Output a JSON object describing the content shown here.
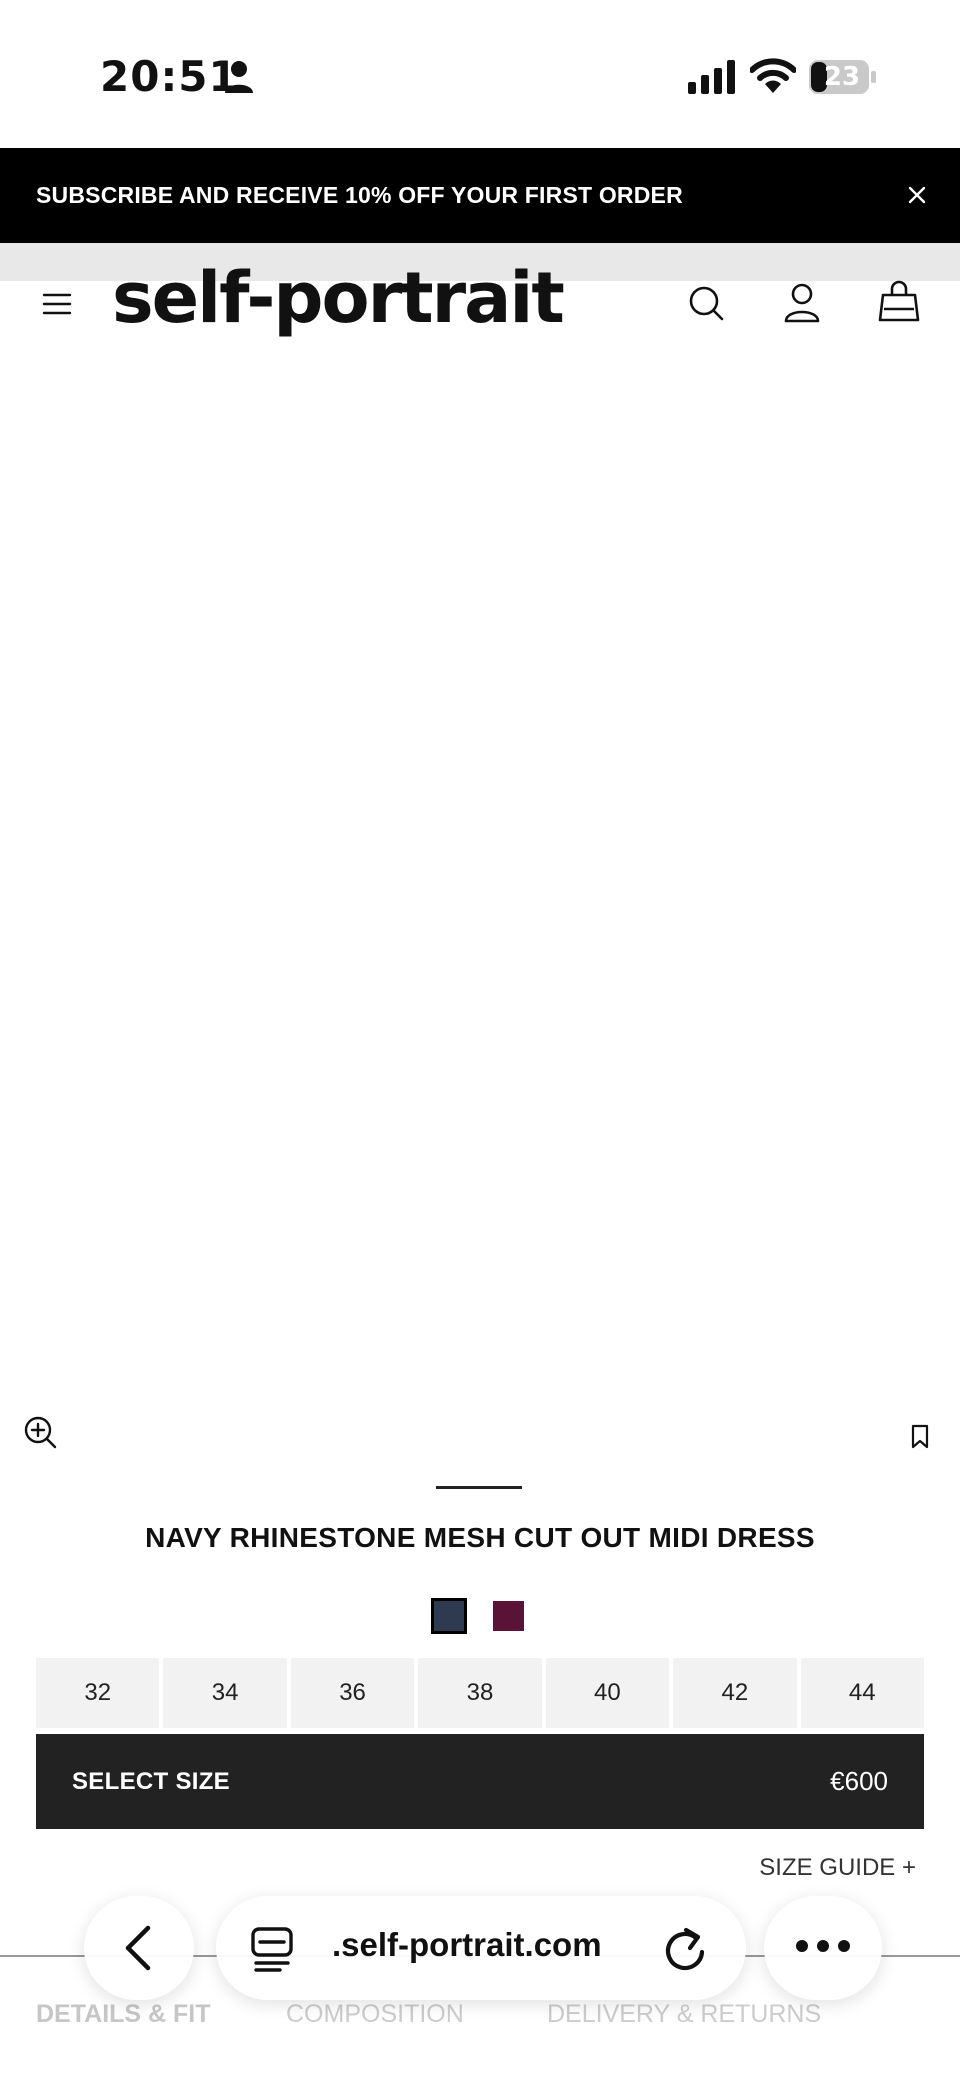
{
  "status_bar": {
    "time": "20:51",
    "battery": "23"
  },
  "promo": {
    "text": "SUBSCRIBE AND RECEIVE 10% OFF YOUR FIRST ORDER"
  },
  "header": {
    "logo": "self-portrait"
  },
  "product": {
    "title": "NAVY RHINESTONE MESH CUT OUT MIDI DRESS",
    "colors": [
      "#2d3a4f",
      "#5a1237"
    ],
    "sizes": [
      "32",
      "34",
      "36",
      "38",
      "40",
      "42",
      "44"
    ],
    "select_label": "SELECT SIZE",
    "price": "€600",
    "size_guide": "SIZE GUIDE  +"
  },
  "tabs": [
    "DETAILS & FIT",
    "COMPOSITION",
    "DELIVERY & RETURNS"
  ],
  "browser": {
    "url": ".self-portrait.com"
  }
}
